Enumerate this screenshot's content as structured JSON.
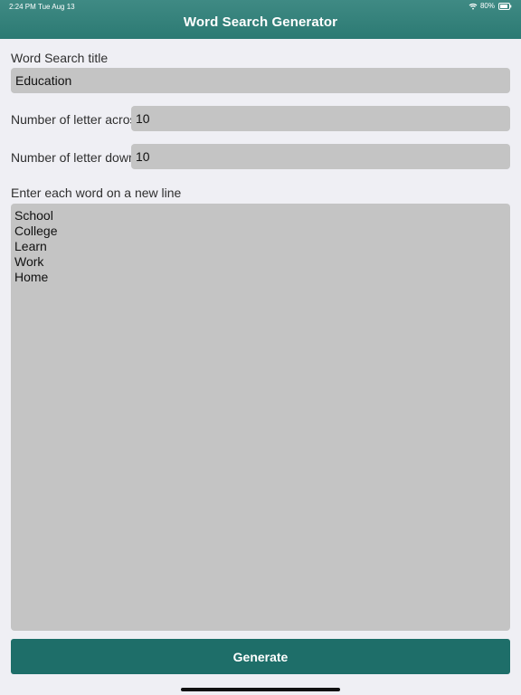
{
  "status_bar": {
    "time": "2:24 PM",
    "date": "Tue Aug 13",
    "battery": "80%"
  },
  "header": {
    "title": "Word Search Generator"
  },
  "form": {
    "title_label": "Word Search title",
    "title_value": "Education",
    "across_label": "Number of letter across",
    "across_value": "10",
    "down_label": "Number of letter down",
    "down_value": "10",
    "words_label": "Enter each word on a new line",
    "words_value": "School\nCollege\nLearn\nWork\nHome"
  },
  "actions": {
    "generate_label": "Generate"
  },
  "colors": {
    "header": "#2c7a73",
    "button": "#1e6e69",
    "field": "#c4c4c4",
    "background": "#efeff4"
  }
}
